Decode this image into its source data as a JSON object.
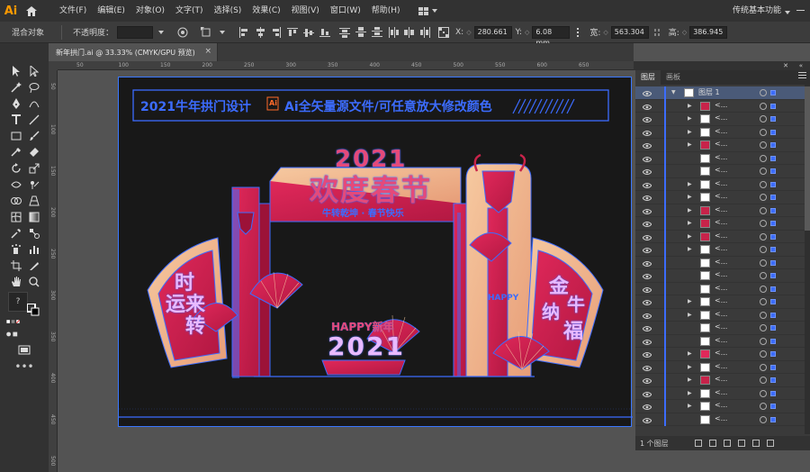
{
  "app": {
    "logo": "Ai",
    "workspace": "传统基本功能"
  },
  "menu": [
    "文件(F)",
    "编辑(E)",
    "对象(O)",
    "文字(T)",
    "选择(S)",
    "效果(C)",
    "视图(V)",
    "窗口(W)",
    "帮助(H)"
  ],
  "control_bar": {
    "selection_type": "混合对象",
    "opacity_label": "不透明度：",
    "x_label": "X:",
    "x_value": "280.661",
    "y_label": "Y:",
    "y_value": "6.08 mm",
    "w_label": "宽:",
    "w_value": "563.304",
    "h_label": "高:",
    "h_value": "386.945"
  },
  "document": {
    "tab_title": "新年拱门.ai @ 33.33% (CMYK/GPU 预览)",
    "close": "×"
  },
  "ruler_h": [
    "50",
    "100",
    "150",
    "200",
    "250",
    "300",
    "350",
    "400",
    "450",
    "500",
    "550",
    "600",
    "650"
  ],
  "ruler_v": [
    "50",
    "100",
    "150",
    "200",
    "250",
    "300",
    "350",
    "400",
    "450",
    "500"
  ],
  "artwork": {
    "banner_left": "2021牛年拱门设计",
    "banner_badge": "Ai",
    "banner_right": "Ai全矢量源文件/可任意放大修改颜色",
    "title_year": "2021",
    "title_main": "欢度春节",
    "subtitle": "牛转乾坤 · 春节快乐",
    "left_panel_text": [
      "时",
      "运来",
      "转"
    ],
    "right_panel_text": [
      "金",
      "牛",
      "纳",
      "福"
    ],
    "bottom_label": "HAPPY新年",
    "bottom_year": "2021",
    "side_label": "HAPPY"
  },
  "layers_panel": {
    "tabs": [
      "图层",
      "画板"
    ],
    "top_layer": "图层 1",
    "sublayer_name": "<...",
    "count": "1 个图层"
  },
  "colors": {
    "accent": "#3c6cff",
    "crimson": "#c8234a",
    "peach": "#f1b98f",
    "artboard": "#181818"
  }
}
